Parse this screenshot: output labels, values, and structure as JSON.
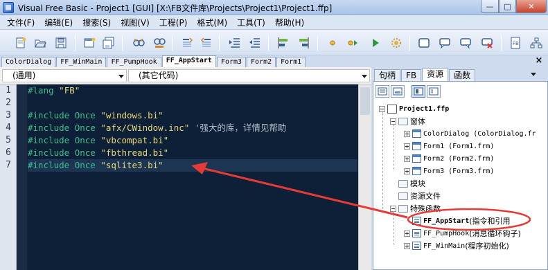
{
  "window": {
    "title": "Visual Free Basic - Project1 [GUI] [X:\\FB文件库\\Projects\\Project1\\Project1.ffp]",
    "controls": {
      "minimize": "—",
      "maximize": "□",
      "close": "✕"
    }
  },
  "menu": {
    "items": [
      "文件(F)",
      "编辑(E)",
      "搜索(S)",
      "视图(V)",
      "工程(P)",
      "格式(M)",
      "工具(T)",
      "帮助(H)"
    ]
  },
  "toolbar": {
    "buttons": [
      "new-file",
      "open-folder",
      "save",
      "new-form",
      "save-all",
      "find",
      "replace",
      "comment",
      "uncomment",
      "indent",
      "outdent",
      "align-left",
      "align-right",
      "stop",
      "run-step",
      "run",
      "settings",
      "window",
      "chat-left",
      "chat-right",
      "close-window",
      "fb-book",
      "project-tree"
    ]
  },
  "editor_tabs": {
    "items": [
      "ColorDialog",
      "FF_WinMain",
      "FF_PumpHook",
      "FF_AppStart",
      "Form3",
      "Form2",
      "Form1"
    ],
    "active": "FF_AppStart"
  },
  "combos": {
    "scope": "(通用)",
    "proc": "(其它代码)"
  },
  "code": {
    "lines": [
      {
        "num": "1",
        "kw": "#lang",
        "str": " \"FB\"",
        "comment": ""
      },
      {
        "num": "2",
        "kw": "",
        "str": "",
        "comment": ""
      },
      {
        "num": "3",
        "kw": "#include Once",
        "str": " \"windows.bi\"",
        "comment": ""
      },
      {
        "num": "4",
        "kw": "#include Once",
        "str": " \"afx/CWindow.inc\"",
        "comment": " '强大的库，详情见帮助"
      },
      {
        "num": "5",
        "kw": "#include Once",
        "str": " \"vbcompat.bi\"",
        "comment": ""
      },
      {
        "num": "6",
        "kw": "#include Once",
        "str": " \"fbthread.bi\"",
        "comment": ""
      },
      {
        "num": "7",
        "kw": "#include Once",
        "str": " \"sqlite3.bi\"",
        "comment": ""
      }
    ]
  },
  "right_panel": {
    "close": "×",
    "tabs": [
      "句柄",
      "FB",
      "资源",
      "函数"
    ],
    "active_tab": "资源",
    "tree": {
      "project": "Project1.ffp",
      "forms_folder": "窗体",
      "forms": [
        {
          "label": "ColorDialog (ColorDialog.fr"
        },
        {
          "label": "Form1 (Form1.frm)"
        },
        {
          "label": "Form2 (Form2.frm)"
        },
        {
          "label": "Form3 (Form3.frm)"
        }
      ],
      "modules_folder": "模块",
      "resources_folder": "资源文件",
      "special_folder": "特殊函数",
      "special": [
        {
          "name": "FF_AppStart",
          "desc": " (指令和引用"
        },
        {
          "name": "FF_PumpHook",
          "desc": " (消息循环钩子)"
        },
        {
          "name": "FF_WinMain",
          "desc": " (程序初始化)"
        }
      ]
    }
  },
  "colors": {
    "editor_bg": "#0e2038",
    "keyword": "#3dbf8a",
    "string": "#e6d77a",
    "annotation": "#e53b36"
  }
}
